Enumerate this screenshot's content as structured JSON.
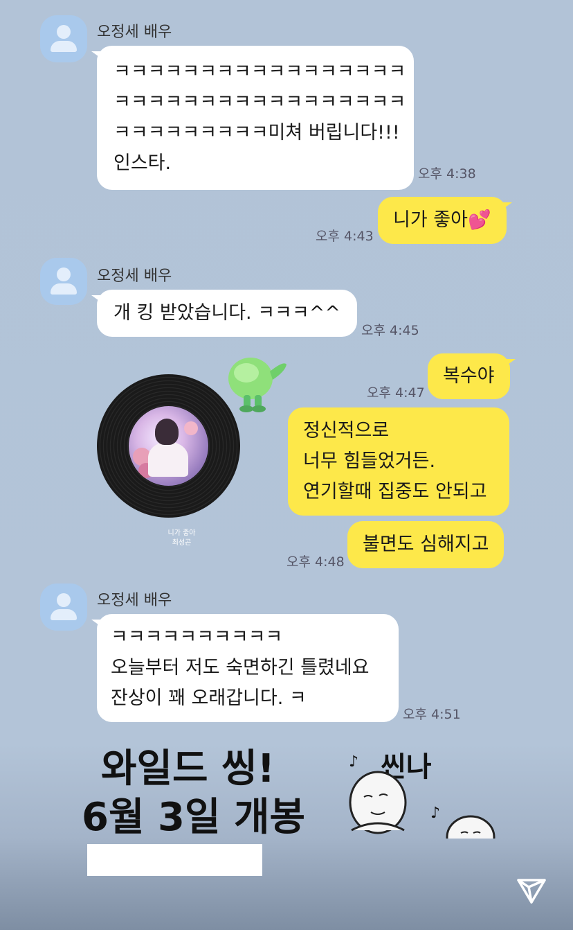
{
  "chat": {
    "sender_name": "오정세 배우",
    "messages": [
      {
        "lines": [
          "ㅋㅋㅋㅋㅋㅋㅋㅋㅋㅋㅋㅋㅋㅋㅋㅋㅋ",
          "ㅋㅋㅋㅋㅋㅋㅋㅋㅋㅋㅋㅋㅋㅋㅋㅋㅋ",
          "ㅋㅋㅋㅋㅋㅋㅋㅋㅋ미쳐 버립니다!!!",
          "인스타."
        ],
        "time": "오후 4:38"
      },
      {
        "text": "니가 좋아",
        "emoji": "💕",
        "time": "오후 4:43"
      },
      {
        "text": "개 킹 받았습니다. ㅋㅋㅋ^^",
        "time": "오후 4:45"
      },
      {
        "text": "복수야",
        "time": "오후 4:47"
      },
      {
        "lines": [
          "정신적으로",
          "너무 힘들었거든.",
          "연기할때 집중도 안되고"
        ]
      },
      {
        "text": "불면도 심해지고",
        "time": "오후 4:48"
      },
      {
        "lines": [
          "ㅋㅋㅋㅋㅋㅋㅋㅋㅋㅋ",
          "오늘부터 저도 숙면하긴 틀렸네요",
          "잔상이 꽤 오래갑니다. ㅋ"
        ],
        "time": "오후 4:51"
      }
    ],
    "music": {
      "title": "니가 좋아",
      "artist": "최성곤"
    }
  },
  "overlay": {
    "headline_1": "와일드 씽!",
    "headline_2": "6월 3일 개봉",
    "sticker_text": "씬나"
  },
  "colors": {
    "background": "#b2c3d7",
    "bubble_out": "#fde84a",
    "bubble_in": "#ffffff",
    "avatar": "#a9c9ec"
  },
  "icons": {
    "send": "send-arrow-icon"
  }
}
